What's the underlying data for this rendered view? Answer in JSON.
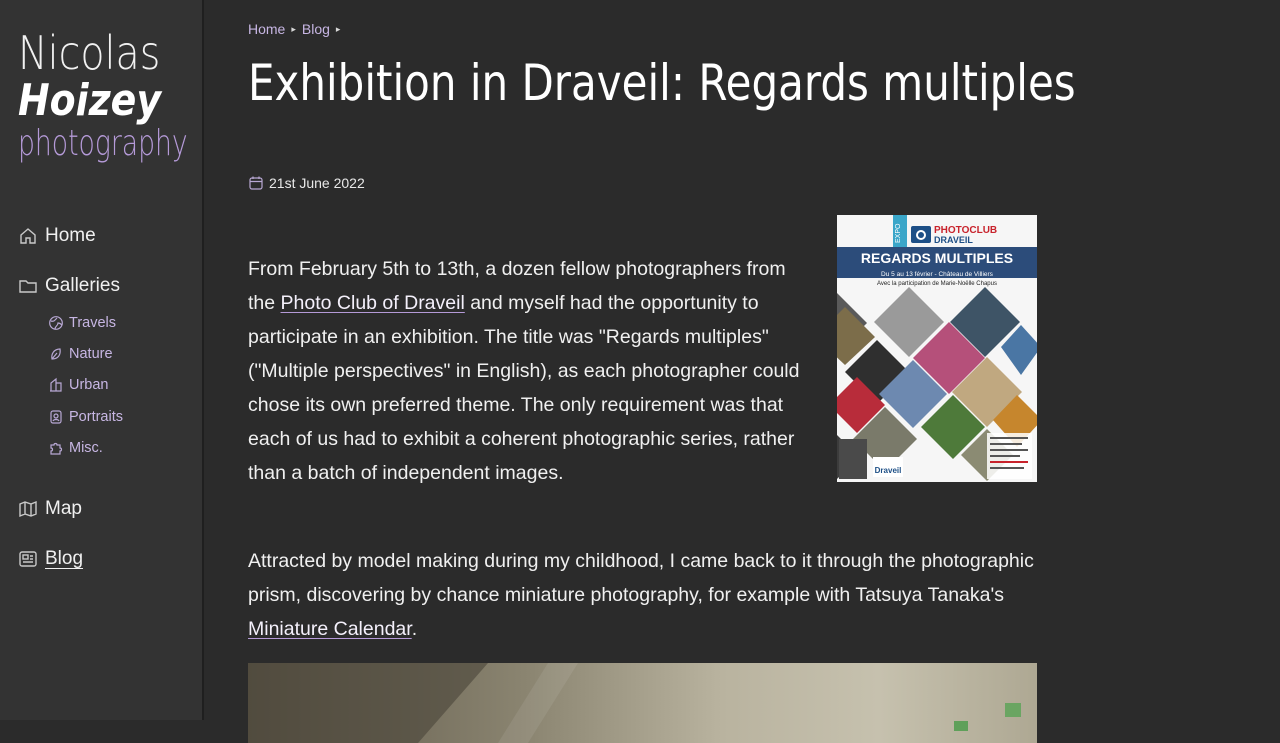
{
  "logo": {
    "first": "Nicolas",
    "last": "Hoizey",
    "tagline": "photography"
  },
  "nav": {
    "home": "Home",
    "galleries": "Galleries",
    "sub": [
      "Travels",
      "Nature",
      "Urban",
      "Portraits",
      "Misc."
    ],
    "map": "Map",
    "blog": "Blog"
  },
  "breadcrumb": [
    "Home",
    "Blog"
  ],
  "post": {
    "title": "Exhibition in Draveil: Regards multiples",
    "date": "21st June 2022",
    "p1_a": "From February 5th to 13th, a dozen fellow photographers from the ",
    "p1_link": "Photo Club of Draveil",
    "p1_b": " and myself had the opportunity to participate in an exhibition. The title was \"Regards multiples\" (\"Multiple perspectives\" in English), as each photographer could chose its own preferred theme. The only requirement was that each of us had to exhibit a coherent photographic series, rather than a batch of independent images.",
    "p2_a": "Attracted by model making during my childhood, I came back to it through the photographic prism, discovering by chance miniature photography, for example with Tatsuya Tanaka's ",
    "p2_link": "Miniature Calendar",
    "p2_b": "."
  },
  "poster": {
    "expo": "EXPO",
    "club": "PHOTOCLUB",
    "city": "DRAVEIL",
    "headline": "REGARDS MULTIPLES",
    "dates": "Du 5 au 13 février - Château de Villiers",
    "guest": "Avec la participation de Marie-Noëlle Chapus",
    "footer": "Draveil"
  },
  "colors": {
    "accent": "#b59ad8",
    "background": "#2b2b2b",
    "sidebar": "#333333"
  }
}
